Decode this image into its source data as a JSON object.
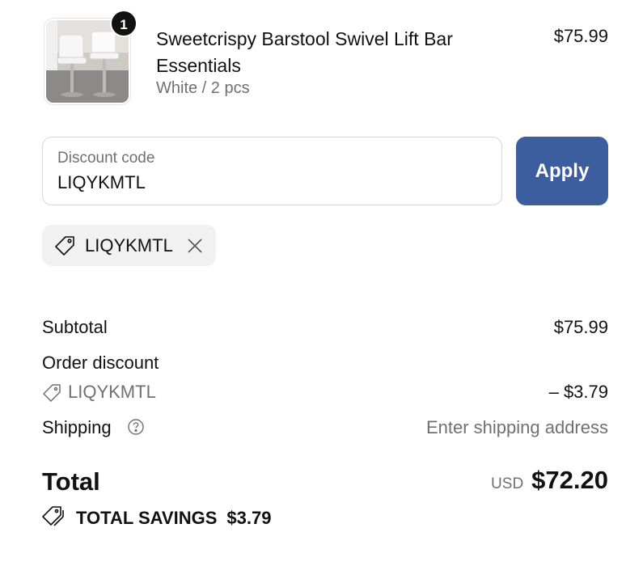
{
  "product": {
    "quantity": "1",
    "title": "Sweetcrispy Barstool Swivel Lift Bar Essentials",
    "variant": "White / 2 pcs",
    "price": "$75.99",
    "image_desc": "white barstools photo"
  },
  "discount": {
    "label": "Discount code",
    "value": "LIQYKMTL",
    "apply_label": "Apply",
    "applied_code": "LIQYKMTL"
  },
  "summary": {
    "subtotal_label": "Subtotal",
    "subtotal_value": "$75.99",
    "order_discount_label": "Order discount",
    "order_discount_code": "LIQYKMTL",
    "order_discount_value": "– $3.79",
    "shipping_label": "Shipping",
    "shipping_value": "Enter shipping address",
    "total_label": "Total",
    "currency": "USD",
    "total_value": "$72.20",
    "savings_label": "TOTAL SAVINGS",
    "savings_value": "$3.79"
  },
  "colors": {
    "accent": "#3d5e9e",
    "muted": "#707070",
    "chip_bg": "#f1f1f1"
  }
}
